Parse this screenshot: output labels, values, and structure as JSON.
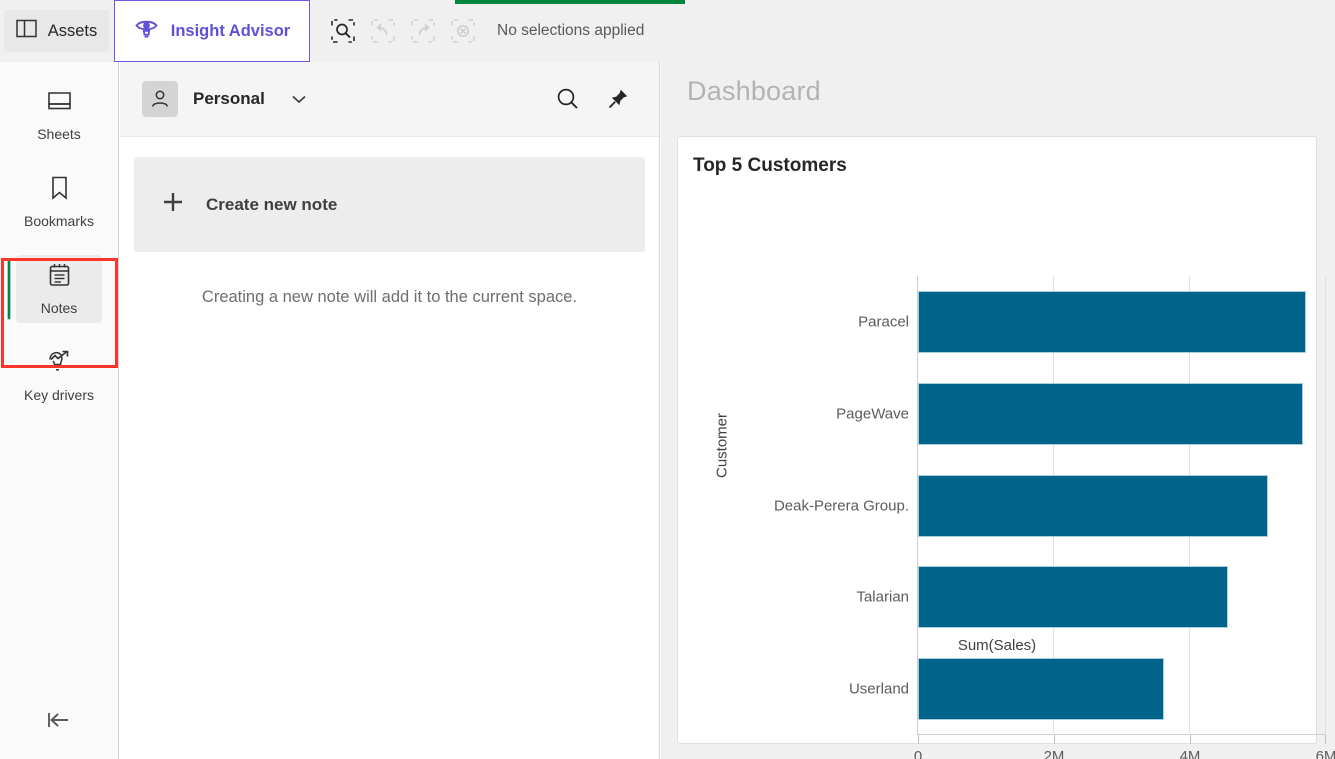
{
  "topbar": {
    "assets_label": "Assets",
    "assets_icon": "panel-layout-icon",
    "insight_advisor_label": "Insight Advisor",
    "insight_advisor_icon": "insight-eye-icon",
    "selection_tools": [
      {
        "name": "selections-search-icon",
        "enabled": true
      },
      {
        "name": "step-back-icon",
        "enabled": false
      },
      {
        "name": "step-forward-icon",
        "enabled": false
      },
      {
        "name": "clear-all-selections-icon",
        "enabled": false
      }
    ],
    "selection_status": "No selections applied",
    "accent_color": "#6b5ce7",
    "active_strip_color": "#00873d"
  },
  "sidebar": {
    "items": [
      {
        "label": "Sheets",
        "icon": "sheets-icon",
        "active": false
      },
      {
        "label": "Bookmarks",
        "icon": "bookmark-icon",
        "active": false
      },
      {
        "label": "Notes",
        "icon": "notepad-icon",
        "active": true
      },
      {
        "label": "Key drivers",
        "icon": "key-drivers-bulb-icon",
        "active": false
      }
    ],
    "collapse_icon": "collapse-left-icon",
    "highlight_color": "#f9352c",
    "active_indicator_color": "#00873d"
  },
  "notes_panel": {
    "space_name": "Personal",
    "avatar_icon": "person-icon",
    "chevron_icon": "chevron-down-icon",
    "search_icon": "search-icon",
    "pin_icon": "pin-icon",
    "create_note_label": "Create new note",
    "create_note_icon": "plus-icon",
    "hint_text": "Creating a new note will add it to the current space."
  },
  "dashboard": {
    "title": "Dashboard"
  },
  "chart_data": {
    "type": "bar",
    "orientation": "horizontal",
    "title": "Top 5 Customers",
    "categories": [
      "Paracel",
      "PageWave",
      "Deak-Perera Group.",
      "Talarian",
      "Userland"
    ],
    "values": [
      5710000,
      5660000,
      5150000,
      4560000,
      3620000
    ],
    "xlabel": "Sum(Sales)",
    "ylabel": "Customer",
    "xlim": [
      0,
      6000000
    ],
    "xticks": [
      0,
      2000000,
      4000000,
      6000000
    ],
    "xtick_labels": [
      "0",
      "2M",
      "4M",
      "6M"
    ],
    "grid": true,
    "legend": "none",
    "bar_color": "#00648a"
  }
}
